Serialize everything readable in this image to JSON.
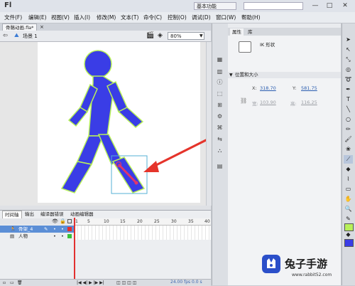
{
  "app": {
    "logo": "Fl",
    "workspace": "基本功能",
    "window_buttons": [
      "—",
      "□",
      "✕"
    ]
  },
  "menu": [
    "文件(F)",
    "编辑(E)",
    "视图(V)",
    "插入(I)",
    "修改(M)",
    "文本(T)",
    "命令(C)",
    "控制(O)",
    "调试(D)",
    "窗口(W)",
    "帮助(H)"
  ],
  "document": {
    "tab_label": "骨骼动画.fla*",
    "scene_label": "场景 1",
    "zoom": "80%"
  },
  "colors": {
    "figure_fill": "#3a3de6",
    "figure_outline": "#b8f05a",
    "bone": "#e0356b",
    "arrow": "#e5342b",
    "selection_box": "#56b0d6",
    "playhead": "#e23030"
  },
  "timeline": {
    "tabs": [
      "时间轴",
      "输出",
      "编译器错误",
      "动画编辑器"
    ],
    "ruler_ticks": [
      "1",
      "5",
      "10",
      "15",
      "20",
      "25",
      "30",
      "35",
      "40"
    ],
    "layers": [
      {
        "name": "骨架_4",
        "selected": true
      },
      {
        "name": "人物",
        "selected": false
      }
    ],
    "fps_text": "24.00 fps",
    "time_text": "0.0 s"
  },
  "properties": {
    "tabs": [
      "属性",
      "库"
    ],
    "object_type": "IK 形状",
    "section_title": "位置和大小",
    "x_label": "X:",
    "x_value": "318.70",
    "y_label": "Y:",
    "y_value": "581.75",
    "w_label": "宽:",
    "w_value": "103.90",
    "h_label": "高:",
    "h_value": "116.25"
  },
  "watermark": {
    "title": "兔子手游",
    "url": "www.rabbit52.com"
  }
}
